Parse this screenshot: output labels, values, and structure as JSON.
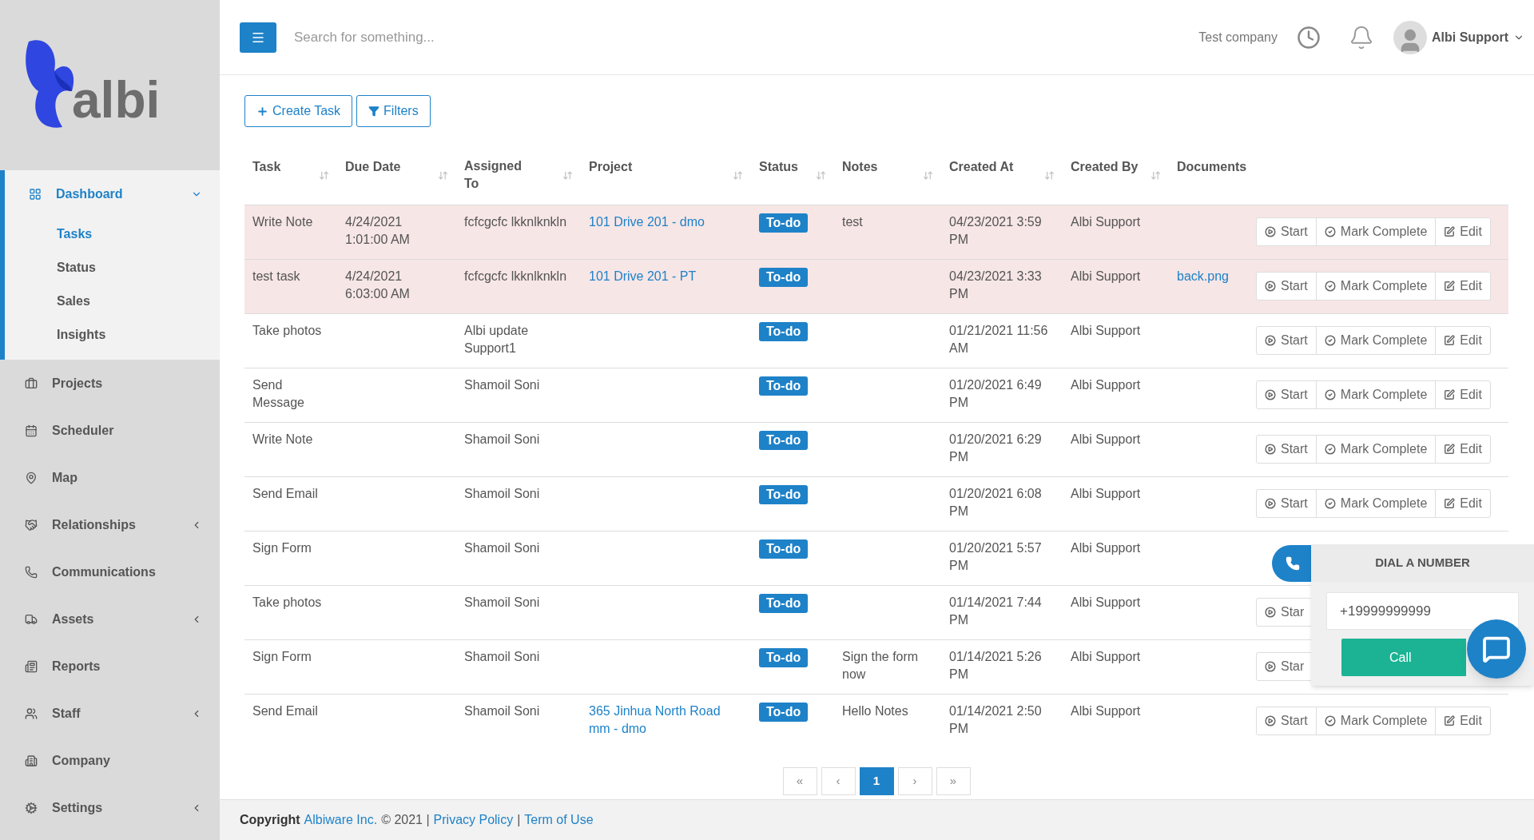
{
  "logo": {
    "text": "albi"
  },
  "sidebar": {
    "items": [
      {
        "label": "Dashboard",
        "selected": true,
        "expanded": true,
        "children": [
          {
            "label": "Tasks",
            "selected": true
          },
          {
            "label": "Status",
            "selected": false
          },
          {
            "label": "Sales",
            "selected": false
          },
          {
            "label": "Insights",
            "selected": false
          }
        ]
      },
      {
        "label": "Projects",
        "selected": false
      },
      {
        "label": "Scheduler",
        "selected": false
      },
      {
        "label": "Map",
        "selected": false
      },
      {
        "label": "Relationships",
        "selected": false,
        "expanded": false
      },
      {
        "label": "Communications",
        "selected": false
      },
      {
        "label": "Assets",
        "selected": false,
        "expanded": false
      },
      {
        "label": "Reports",
        "selected": false
      },
      {
        "label": "Staff",
        "selected": false,
        "expanded": false
      },
      {
        "label": "Company",
        "selected": false
      },
      {
        "label": "Settings",
        "selected": false,
        "expanded": false
      }
    ]
  },
  "header": {
    "search": {
      "placeholder": "Search for something..."
    },
    "company": "Test company",
    "user": "Albi Support"
  },
  "toolbar": [
    "Create Task",
    "Filters"
  ],
  "table": {
    "columns": [
      {
        "label": "Task",
        "sortable": true
      },
      {
        "label": "Due Date",
        "sortable": true
      },
      {
        "label": "Assigned To",
        "sortable": true
      },
      {
        "label": "Project",
        "sortable": true
      },
      {
        "label": "Status",
        "sortable": true
      },
      {
        "label": "Notes",
        "sortable": true
      },
      {
        "label": "Created At",
        "sortable": true
      },
      {
        "label": "Created By",
        "sortable": true
      },
      {
        "label": "Documents",
        "sortable": false
      }
    ],
    "rows": [
      {
        "task": "Write Note",
        "due": "4/24/2021 1:01:00 AM",
        "assigned": "fcfcgcfc lkknlknkln",
        "project": "101 Drive 201 - dmo",
        "status": "To-do",
        "notes": "test",
        "created_at": "04/23/2021 3:59 PM",
        "created_by": "Albi Support",
        "overdue": true,
        "actions": [
          "Start",
          "Mark Complete",
          "Edit"
        ]
      },
      {
        "task": "test task",
        "due": "4/24/2021 6:03:00 AM",
        "assigned": "fcfcgcfc lkknlknkln",
        "project": "101 Drive 201 - PT",
        "status": "To-do",
        "created_at": "04/23/2021 3:33 PM",
        "created_by": "Albi Support",
        "document": "back.png",
        "overdue": true,
        "actions": [
          "Start",
          "Mark Complete",
          "Edit"
        ]
      },
      {
        "task": "Take photos",
        "assigned": "Albi update Support1",
        "status": "To-do",
        "created_at": "01/21/2021 11:56 AM",
        "created_by": "Albi Support",
        "overdue": false,
        "actions": [
          "Start",
          "Mark Complete",
          "Edit"
        ]
      },
      {
        "task": "Send Message",
        "assigned": "Shamoil Soni",
        "status": "To-do",
        "created_at": "01/20/2021 6:49 PM",
        "created_by": "Albi Support",
        "overdue": false,
        "actions": [
          "Start",
          "Mark Complete",
          "Edit"
        ]
      },
      {
        "task": "Write Note",
        "assigned": "Shamoil Soni",
        "status": "To-do",
        "created_at": "01/20/2021 6:29 PM",
        "created_by": "Albi Support",
        "overdue": false,
        "actions": [
          "Start",
          "Mark Complete",
          "Edit"
        ]
      },
      {
        "task": "Send Email",
        "assigned": "Shamoil Soni",
        "status": "To-do",
        "created_at": "01/20/2021 6:08 PM",
        "created_by": "Albi Support",
        "overdue": false,
        "actions": [
          "Start",
          "Mark Complete",
          "Edit"
        ]
      },
      {
        "task": "Sign Form",
        "assigned": "Shamoil Soni",
        "status": "To-do",
        "created_at": "01/20/2021 5:57 PM",
        "created_by": "Albi Support",
        "overdue": false
      },
      {
        "task": "Take photos",
        "assigned": "Shamoil Soni",
        "status": "To-do",
        "created_at": "01/14/2021 7:44 PM",
        "created_by": "Albi Support",
        "overdue": false,
        "actions": [
          "Star"
        ]
      },
      {
        "task": "Sign Form",
        "assigned": "Shamoil Soni",
        "status": "To-do",
        "notes": "Sign the form now",
        "created_at": "01/14/2021 5:26 PM",
        "created_by": "Albi Support",
        "overdue": false,
        "actions": [
          "Star"
        ]
      },
      {
        "task": "Send Email",
        "assigned": "Shamoil Soni",
        "project": "365 Jinhua North Road mm - dmo",
        "status": "To-do",
        "notes": "Hello Notes",
        "created_at": "01/14/2021 2:50 PM",
        "created_by": "Albi Support",
        "overdue": false,
        "actions": [
          "Start",
          "Mark Complete",
          "Edit"
        ]
      }
    ]
  },
  "pagination": [
    {
      "label": "«",
      "selected": false
    },
    {
      "label": "‹",
      "selected": false
    },
    {
      "label": "1",
      "selected": true
    },
    {
      "label": "›",
      "selected": false
    },
    {
      "label": "»",
      "selected": false
    }
  ],
  "footer": {
    "copyright": "Copyright",
    "company_link": "Albiware Inc.",
    "year": "© 2021 |",
    "privacy_link": "Privacy Policy",
    "separator": "|",
    "terms_link": "Term of Use"
  },
  "dialer": {
    "title": "DIAL A NUMBER",
    "value": "+19999999999",
    "button": "Call"
  }
}
